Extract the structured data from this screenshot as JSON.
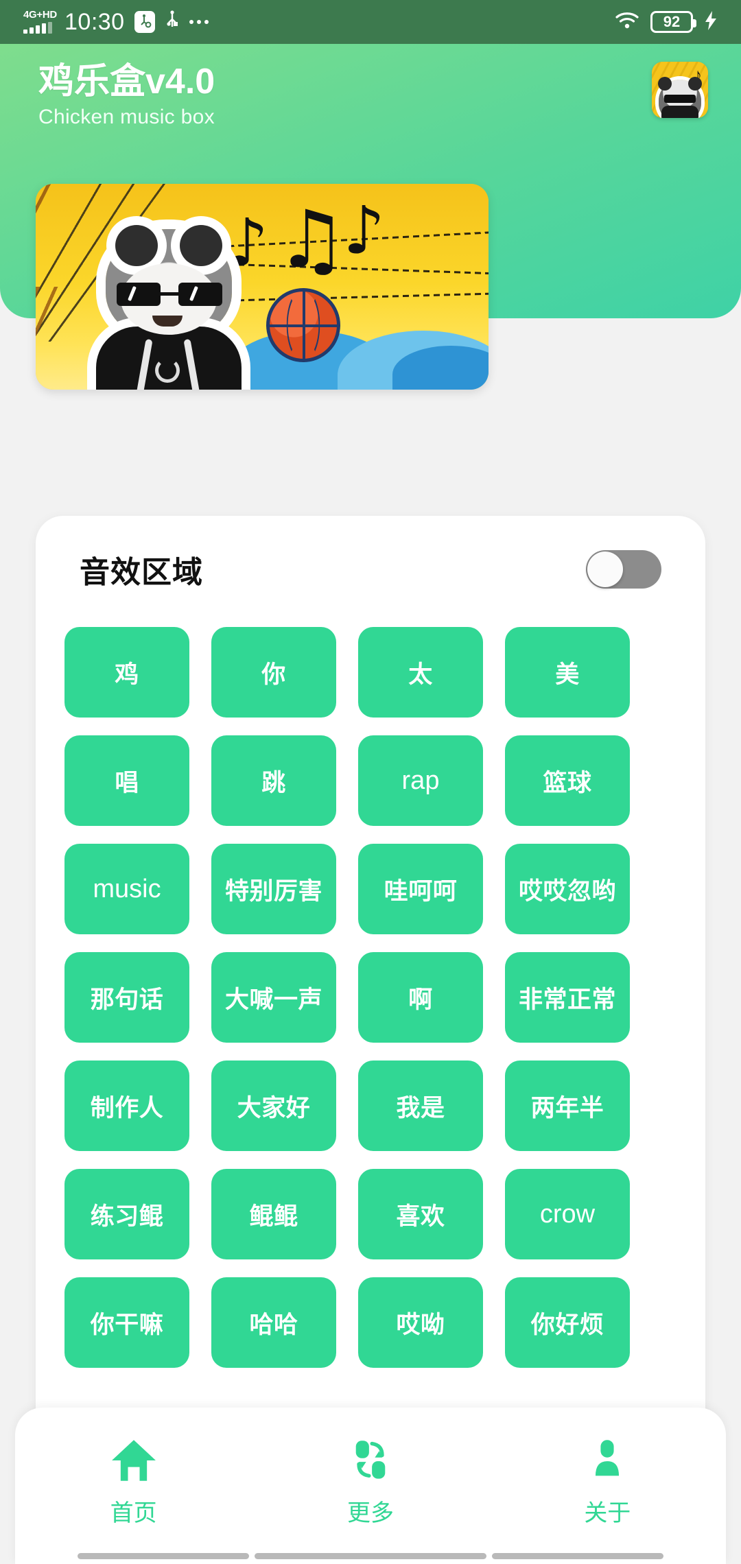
{
  "status_bar": {
    "network_type": "4G+HD",
    "time": "10:30",
    "usb_debug_icon": "usb-debug-icon",
    "usb_icon": "usb-icon",
    "overflow_icon": "more-dots-icon",
    "wifi_icon": "wifi-icon",
    "battery_level": "92",
    "charging_icon": "charging-bolt-icon",
    "bg_color": "#3d7a4e"
  },
  "header": {
    "app_title": "鸡乐盒v4.0",
    "app_subtitle": "Chicken music box",
    "app_icon_name": "app-logo-panda-icon",
    "gradient_from": "#7fdd8d",
    "gradient_to": "#3fd2a6"
  },
  "banner": {
    "name": "hero-banner-image",
    "description": "panda-sunglasses-basketball-chicken-music",
    "bg_color": "#f7cf1e"
  },
  "sound_card": {
    "title": "音效区域",
    "toggle": {
      "name": "sound-area-toggle",
      "state": "off",
      "track_color": "#8c8c8c",
      "knob_color": "#fbfbfb"
    },
    "button_color": "#31d794",
    "buttons": [
      {
        "label": "鸡",
        "lang": "zh"
      },
      {
        "label": "你",
        "lang": "zh"
      },
      {
        "label": "太",
        "lang": "zh"
      },
      {
        "label": "美",
        "lang": "zh"
      },
      {
        "label": "唱",
        "lang": "zh"
      },
      {
        "label": "跳",
        "lang": "zh"
      },
      {
        "label": "rap",
        "lang": "en"
      },
      {
        "label": "篮球",
        "lang": "zh"
      },
      {
        "label": "music",
        "lang": "en"
      },
      {
        "label": "特别厉害",
        "lang": "zh"
      },
      {
        "label": "哇呵呵",
        "lang": "zh"
      },
      {
        "label": "哎哎忽哟",
        "lang": "zh"
      },
      {
        "label": "那句话",
        "lang": "zh"
      },
      {
        "label": "大喊一声",
        "lang": "zh"
      },
      {
        "label": "啊",
        "lang": "zh"
      },
      {
        "label": "非常正常",
        "lang": "zh"
      },
      {
        "label": "制作人",
        "lang": "zh"
      },
      {
        "label": "大家好",
        "lang": "zh"
      },
      {
        "label": "我是",
        "lang": "zh"
      },
      {
        "label": "两年半",
        "lang": "zh"
      },
      {
        "label": "练习鲲",
        "lang": "zh"
      },
      {
        "label": "鲲鲲",
        "lang": "zh"
      },
      {
        "label": "喜欢",
        "lang": "zh"
      },
      {
        "label": "crow",
        "lang": "en"
      },
      {
        "label": "你干嘛",
        "lang": "zh"
      },
      {
        "label": "哈哈",
        "lang": "zh"
      },
      {
        "label": "哎呦",
        "lang": "zh"
      },
      {
        "label": "你好烦",
        "lang": "zh"
      }
    ]
  },
  "bottom_nav": {
    "active_color": "#31d794",
    "items": [
      {
        "label": "首页",
        "icon": "home-icon",
        "active": true
      },
      {
        "label": "更多",
        "icon": "refresh-icon",
        "active": false
      },
      {
        "label": "关于",
        "icon": "person-icon",
        "active": false
      }
    ]
  }
}
